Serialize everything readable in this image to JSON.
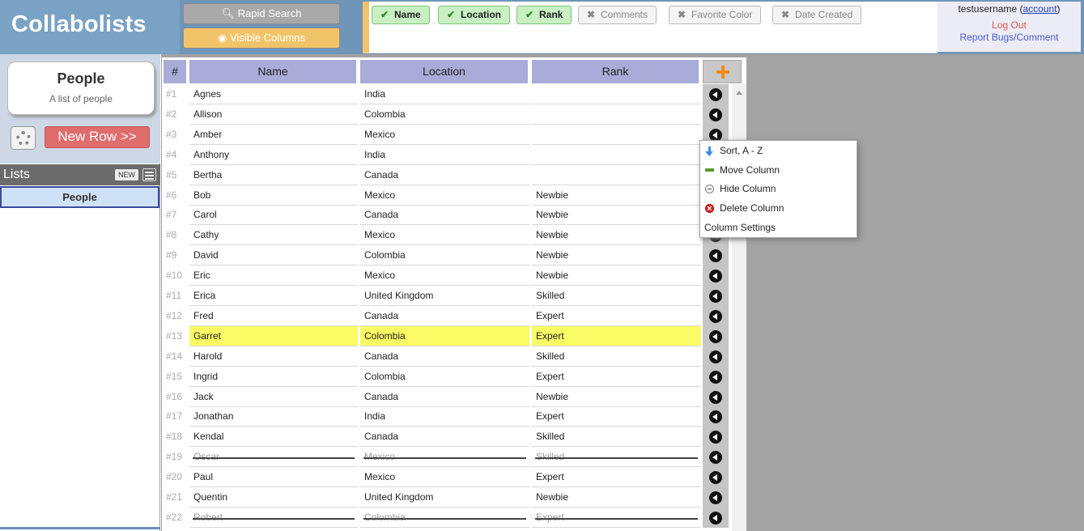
{
  "app": {
    "title": "Collabolists"
  },
  "toolbar": {
    "rapid_search_label": "Rapid Search",
    "visible_columns_label": "Visible Columns"
  },
  "columns_toggle": [
    {
      "label": "Name",
      "visible": true
    },
    {
      "label": "Location",
      "visible": true
    },
    {
      "label": "Rank",
      "visible": true
    },
    {
      "label": "Comments",
      "visible": false
    },
    {
      "label": "Favorite Color",
      "visible": false
    },
    {
      "label": "Date Created",
      "visible": false
    }
  ],
  "user": {
    "username": "testusername",
    "account_link": "account",
    "logout": "Log Out",
    "report": "Report Bugs/Comment"
  },
  "sidebar": {
    "list_card": {
      "title": "People",
      "description": "A list of people"
    },
    "new_row_label": "New Row >>",
    "lists_header": "Lists",
    "new_badge": "NEW",
    "lists": [
      {
        "label": "People",
        "selected": true
      }
    ]
  },
  "grid": {
    "headers": {
      "num": "#",
      "name": "Name",
      "location": "Location",
      "rank": "Rank"
    },
    "rows": [
      {
        "num": "#1",
        "name": "Agnes",
        "location": "India",
        "rank": "",
        "highlight": false,
        "struck": false
      },
      {
        "num": "#2",
        "name": "Allison",
        "location": "Colombia",
        "rank": "",
        "highlight": false,
        "struck": false
      },
      {
        "num": "#3",
        "name": "Amber",
        "location": "Mexico",
        "rank": "",
        "highlight": false,
        "struck": false
      },
      {
        "num": "#4",
        "name": "Anthony",
        "location": "India",
        "rank": "",
        "highlight": false,
        "struck": false
      },
      {
        "num": "#5",
        "name": "Bertha",
        "location": "Canada",
        "rank": "",
        "highlight": false,
        "struck": false
      },
      {
        "num": "#6",
        "name": "Bob",
        "location": "Mexico",
        "rank": "Newbie",
        "highlight": false,
        "struck": false
      },
      {
        "num": "#7",
        "name": "Carol",
        "location": "Canada",
        "rank": "Newbie",
        "highlight": false,
        "struck": false
      },
      {
        "num": "#8",
        "name": "Cathy",
        "location": "Mexico",
        "rank": "Newbie",
        "highlight": false,
        "struck": false
      },
      {
        "num": "#9",
        "name": "David",
        "location": "Colombia",
        "rank": "Newbie",
        "highlight": false,
        "struck": false
      },
      {
        "num": "#10",
        "name": "Eric",
        "location": "Mexico",
        "rank": "Newbie",
        "highlight": false,
        "struck": false
      },
      {
        "num": "#11",
        "name": "Erica",
        "location": "United Kingdom",
        "rank": "Skilled",
        "highlight": false,
        "struck": false
      },
      {
        "num": "#12",
        "name": "Fred",
        "location": "Canada",
        "rank": "Expert",
        "highlight": false,
        "struck": false
      },
      {
        "num": "#13",
        "name": "Garret",
        "location": "Colombia",
        "rank": "Expert",
        "highlight": true,
        "struck": false
      },
      {
        "num": "#14",
        "name": "Harold",
        "location": "Canada",
        "rank": "Skilled",
        "highlight": false,
        "struck": false
      },
      {
        "num": "#15",
        "name": "Ingrid",
        "location": "Colombia",
        "rank": "Expert",
        "highlight": false,
        "struck": false
      },
      {
        "num": "#16",
        "name": "Jack",
        "location": "Canada",
        "rank": "Newbie",
        "highlight": false,
        "struck": false
      },
      {
        "num": "#17",
        "name": "Jonathan",
        "location": "India",
        "rank": "Expert",
        "highlight": false,
        "struck": false
      },
      {
        "num": "#18",
        "name": "Kendal",
        "location": "Canada",
        "rank": "Skilled",
        "highlight": false,
        "struck": false
      },
      {
        "num": "#19",
        "name": "Oscar",
        "location": "Mexico",
        "rank": "Skilled",
        "highlight": false,
        "struck": true
      },
      {
        "num": "#20",
        "name": "Paul",
        "location": "Mexico",
        "rank": "Expert",
        "highlight": false,
        "struck": false
      },
      {
        "num": "#21",
        "name": "Quentin",
        "location": "United Kingdom",
        "rank": "Newbie",
        "highlight": false,
        "struck": false
      },
      {
        "num": "#22",
        "name": "Robert",
        "location": "Colombia",
        "rank": "Expert",
        "highlight": false,
        "struck": true
      }
    ]
  },
  "context_menu": {
    "items": [
      {
        "label": "Sort, A - Z",
        "icon": "sort-down-arrow-icon"
      },
      {
        "label": "Move Column",
        "icon": "move-arrows-icon"
      },
      {
        "label": "Hide Column",
        "icon": "hide-minus-icon"
      },
      {
        "label": "Delete Column",
        "icon": "delete-x-icon"
      },
      {
        "label": "Column Settings",
        "icon": ""
      }
    ]
  },
  "colors": {
    "header_bg": "#a9abd8",
    "highlight": "#fbfb66",
    "visible_columns": "#f2c46a",
    "new_row": "#e06c6c",
    "chip_on": "#c8f0c2",
    "topbar": "#6f95b8"
  }
}
